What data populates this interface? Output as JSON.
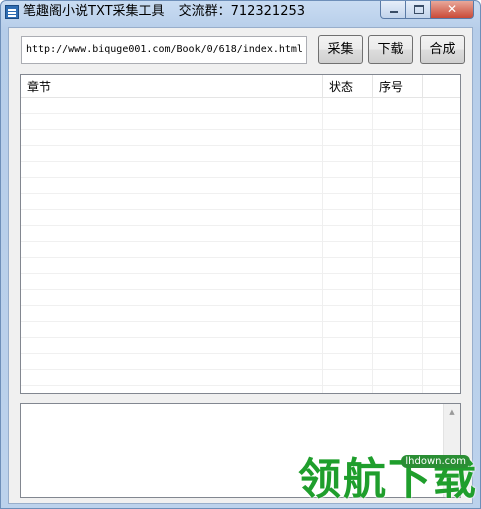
{
  "window": {
    "title": "笔趣阁小说TXT采集工具",
    "group": "交流群：712321253"
  },
  "toolbar": {
    "url_value": "http://www.biquge001.com/Book/0/618/index.html",
    "collect_label": "采集",
    "download_label": "下载",
    "merge_label": "合成"
  },
  "list": {
    "columns": [
      "章节",
      "状态",
      "序号"
    ],
    "rows": []
  },
  "log": {
    "text": ""
  },
  "watermark": {
    "text": "领航下载",
    "domain": "lhdown.com"
  },
  "icons": {
    "app": "app-icon",
    "minimize": "minimize-icon",
    "maximize": "maximize-icon",
    "close": "close-icon",
    "scroll_up": "scroll-up-icon"
  }
}
